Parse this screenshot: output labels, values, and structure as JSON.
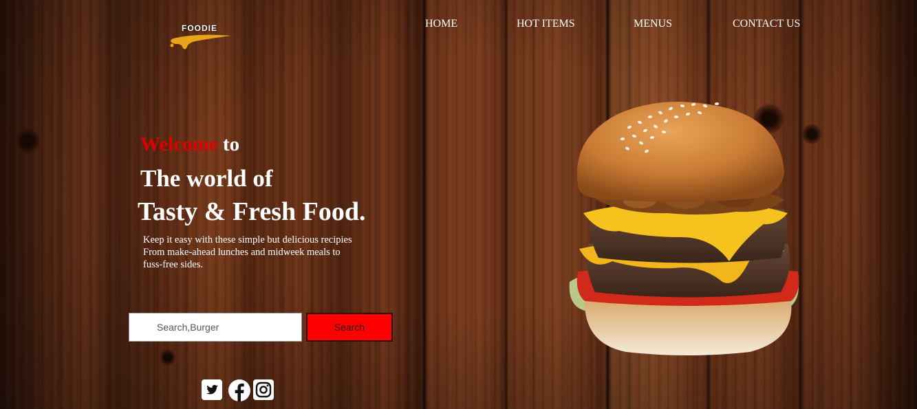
{
  "brand": {
    "logo_text": "FOODIE",
    "accent": "#e8a41a"
  },
  "nav": {
    "items": [
      {
        "label": "HOME"
      },
      {
        "label": "HOT ITEMS"
      },
      {
        "label": "MENUS"
      },
      {
        "label": "CONTACT US"
      }
    ]
  },
  "hero": {
    "welcome": "Welcome",
    "to": " to",
    "line2": "The world of",
    "line3": "Tasty & Fresh Food.",
    "description_line1": "Keep it easy with these simple but delicious recipies",
    "description_line2": "From make-ahead lunches and midweek meals to",
    "description_line3": "fuss-free sides."
  },
  "search": {
    "placeholder": "Search,Burger",
    "button_label": "Search",
    "button_color": "#ff0000"
  },
  "social": {
    "icons": [
      "twitter-icon",
      "facebook-icon",
      "instagram-icon"
    ]
  },
  "colors": {
    "welcome_red": "#e00000",
    "text": "#ffffff"
  }
}
